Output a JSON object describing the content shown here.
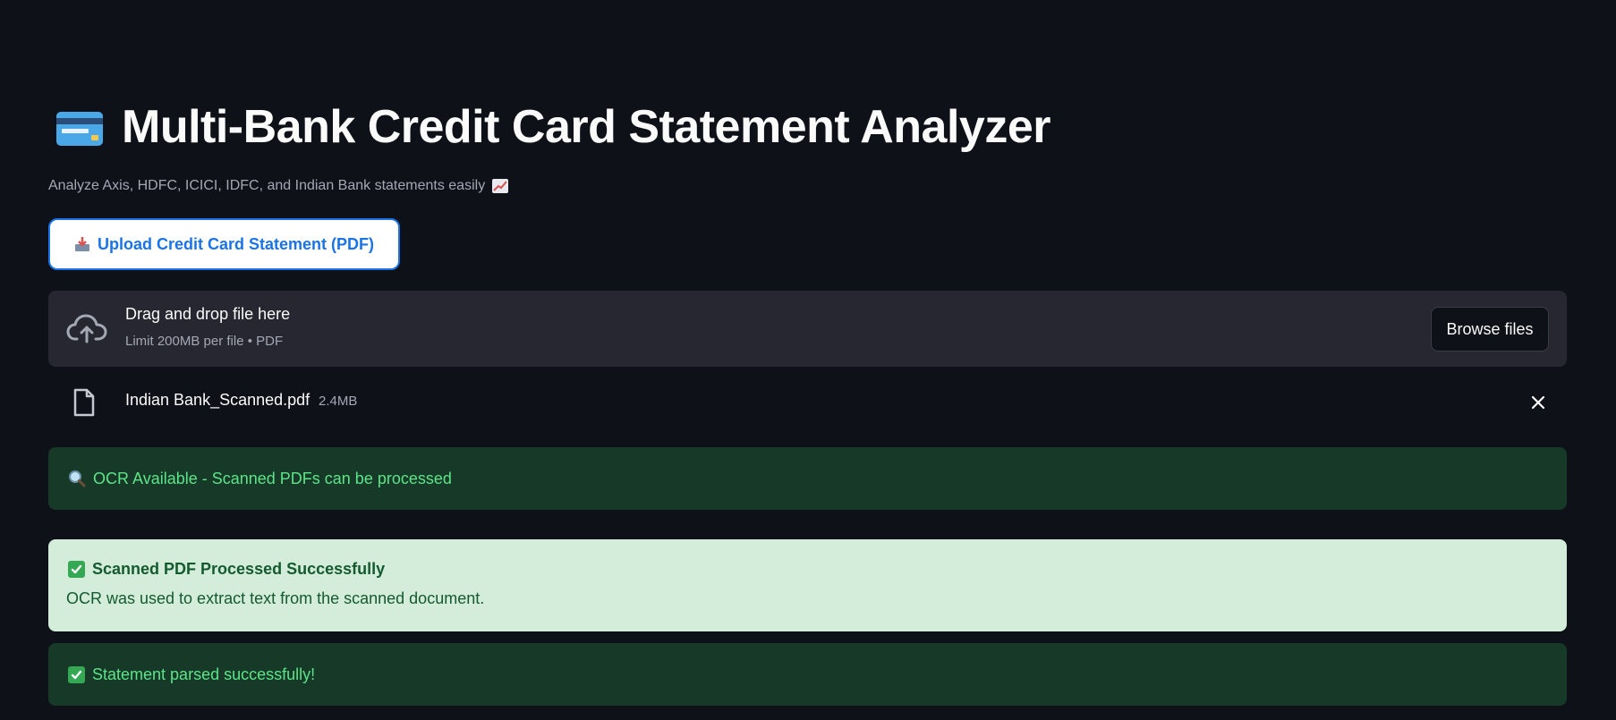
{
  "header": {
    "title": "Multi-Bank Credit Card Statement Analyzer",
    "title_icon": "credit-card-icon",
    "subtitle": "Analyze Axis, HDFC, ICICI, IDFC, and Indian Bank statements easily"
  },
  "upload_button": {
    "label": "Upload Credit Card Statement (PDF)",
    "icon": "inbox-tray-icon"
  },
  "dropzone": {
    "title": "Drag and drop file here",
    "subtitle": "Limit 200MB per file • PDF",
    "browse_label": "Browse files",
    "icon": "cloud-upload-icon"
  },
  "uploaded_file": {
    "name": "Indian Bank_Scanned.pdf",
    "size": "2.4MB",
    "icon": "file-icon"
  },
  "alerts": {
    "ocr": {
      "text": "OCR Available - Scanned PDFs can be processed",
      "icon": "magnifier-icon"
    },
    "scanned": {
      "title": "Scanned PDF Processed Successfully",
      "body": "OCR was used to extract text from the scanned document.",
      "icon": "check-mark-icon"
    },
    "parsed": {
      "text": "Statement parsed successfully!",
      "icon": "check-mark-icon"
    }
  },
  "colors": {
    "background": "#0e1117",
    "accent": "#1a73e8",
    "success_dark": "#173928",
    "success_text": "#5ce488",
    "success_light": "#d4eddb"
  }
}
